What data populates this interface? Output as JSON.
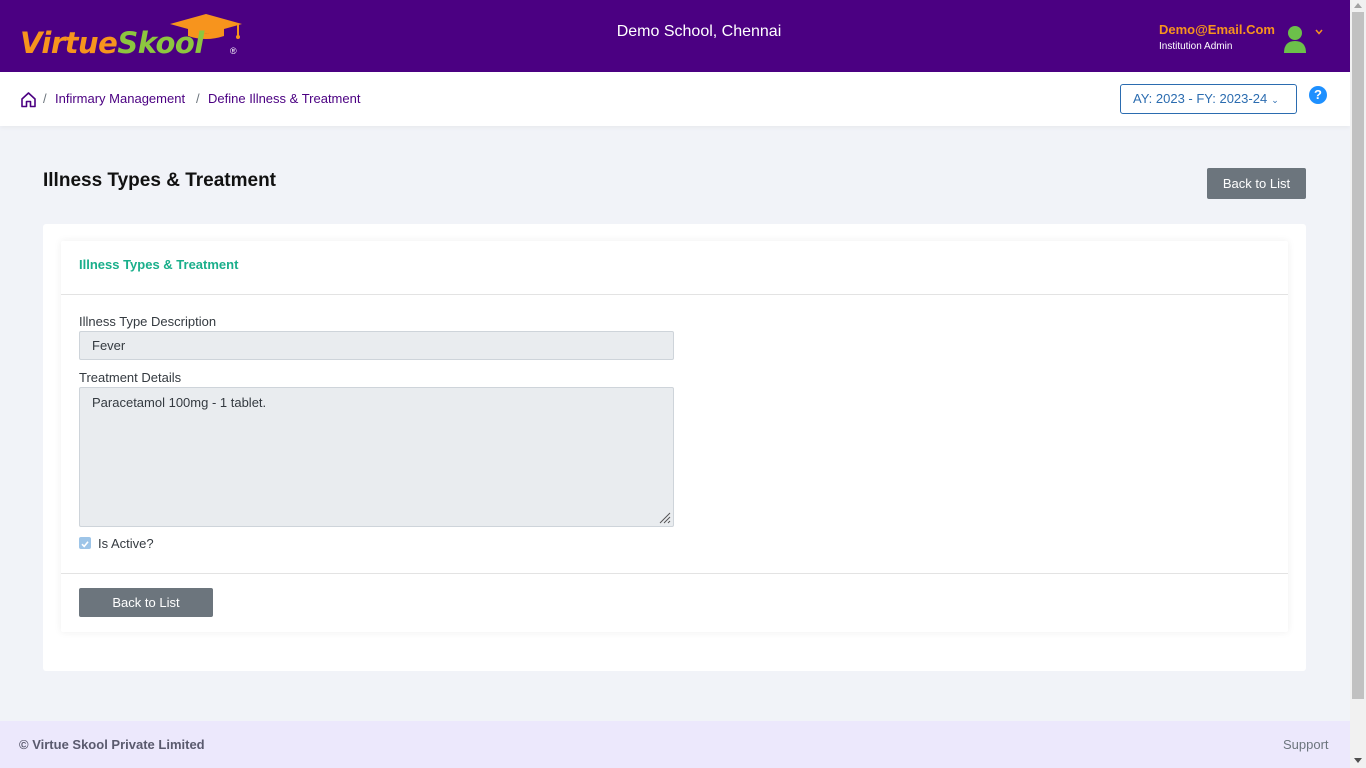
{
  "header": {
    "logo": {
      "part1": "Virtue",
      "part2": "Skool",
      "reg": "®"
    },
    "school_name": "Demo School, Chennai",
    "user": {
      "email": "Demo@Email.Com",
      "role": "Institution Admin"
    }
  },
  "breadcrumb": {
    "items": [
      "Infirmary Management",
      "Define Illness & Treatment"
    ],
    "separator": "/"
  },
  "academic_year": {
    "selected": "AY: 2023 - FY: 2023-24"
  },
  "help": {
    "label": "?"
  },
  "page": {
    "title": "Illness Types & Treatment",
    "back_button_label": "Back to List"
  },
  "form": {
    "card_title": "Illness Types & Treatment",
    "illness_type": {
      "label": "Illness Type Description",
      "value": "Fever"
    },
    "treatment": {
      "label": "Treatment Details",
      "value": "Paracetamol 100mg - 1 tablet."
    },
    "is_active": {
      "label": "Is Active?",
      "checked": true
    },
    "back_button_label": "Back to List"
  },
  "footer": {
    "copyright": "© Virtue Skool Private Limited",
    "support": "Support"
  },
  "colors": {
    "header_bg": "#4b0082",
    "accent_orange": "#f7941d",
    "accent_green": "#8dc63f",
    "card_title": "#1aaf8b",
    "select_blue": "#2b6cb0",
    "footer_bg": "#ece8fc"
  },
  "icons": [
    "graduation-cap-icon",
    "user-icon",
    "chevron-down-icon",
    "home-icon",
    "help-icon",
    "resize-grip-icon",
    "checkbox-checked-icon"
  ]
}
